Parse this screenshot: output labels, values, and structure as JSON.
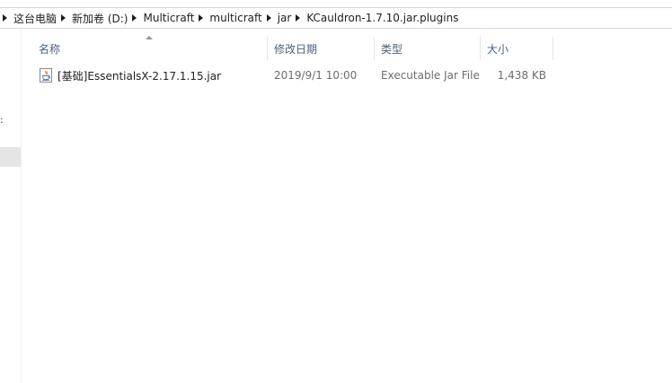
{
  "breadcrumb": {
    "items": [
      {
        "label": "这台电脑"
      },
      {
        "label": "新加卷 (D:)"
      },
      {
        "label": "Multicraft"
      },
      {
        "label": "multicraft"
      },
      {
        "label": "jar"
      },
      {
        "label": "KCauldron-1.7.10.jar.plugins"
      }
    ]
  },
  "nav": {
    "partial_mark": ":"
  },
  "columns": {
    "name": "名称",
    "date": "修改日期",
    "type": "类型",
    "size": "大小",
    "sorted_by": "name"
  },
  "files": [
    {
      "icon": "java-jar-icon",
      "name": "[基础]EssentialsX-2.17.1.15.jar",
      "date": "2019/9/1 10:00",
      "type": "Executable Jar File",
      "size": "1,438 KB"
    }
  ],
  "colors": {
    "header_text": "#4c607a",
    "detail_text": "#6d6d6d"
  }
}
